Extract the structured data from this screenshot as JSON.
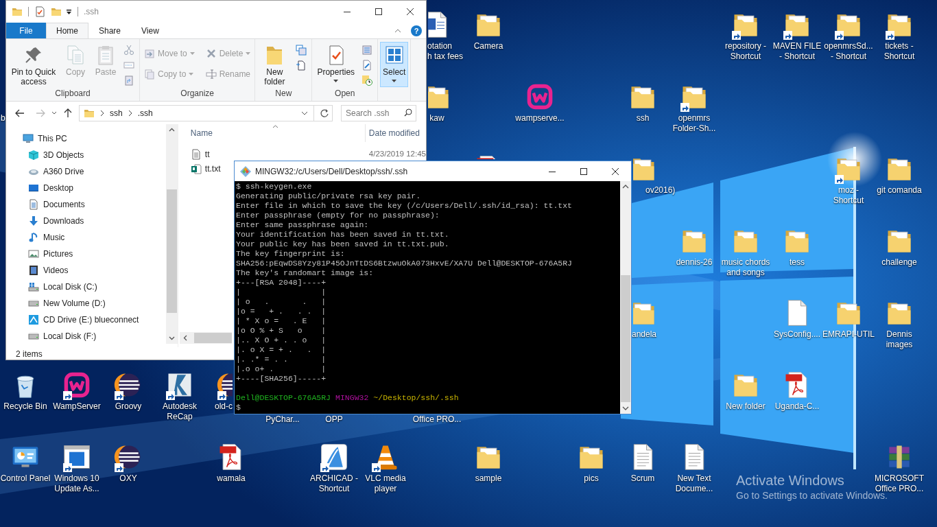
{
  "explorer": {
    "title": ".ssh",
    "tabs": [
      {
        "label": "File",
        "kind": "menu",
        "selected": false
      },
      {
        "label": "Home",
        "kind": "tab",
        "selected": true
      },
      {
        "label": "Share",
        "kind": "tab",
        "selected": false
      },
      {
        "label": "View",
        "kind": "tab",
        "selected": false
      }
    ],
    "help_label": "?",
    "ribbon": [
      {
        "label": "Clipboard",
        "items": [
          {
            "label": "Pin to Quick access",
            "kind": "pin",
            "disabled": false,
            "highlighted": false
          },
          {
            "label": "Copy",
            "kind": "copy",
            "disabled": true,
            "highlighted": false
          },
          {
            "label": "Paste",
            "kind": "paste",
            "disabled": true,
            "highlighted": false
          }
        ]
      },
      {
        "label": "Organize",
        "items": [
          {
            "label": "Move to",
            "kind": "moveto",
            "disabled": true,
            "highlighted": false
          },
          {
            "label": "Copy to",
            "kind": "copyto",
            "disabled": true,
            "highlighted": false
          },
          {
            "label": "Delete",
            "kind": "delete",
            "disabled": true,
            "highlighted": false
          },
          {
            "label": "Rename",
            "kind": "rename",
            "disabled": true,
            "highlighted": false
          }
        ]
      },
      {
        "label": "New",
        "items": [
          {
            "label": "New folder",
            "kind": "newfolder",
            "disabled": false,
            "highlighted": false
          }
        ]
      },
      {
        "label": "Open",
        "items": [
          {
            "label": "Properties",
            "kind": "properties",
            "disabled": false,
            "highlighted": false
          }
        ]
      },
      {
        "items": [
          {
            "label": "Select",
            "kind": "select",
            "disabled": false,
            "highlighted": true
          }
        ]
      }
    ],
    "path": [
      "ssh",
      ".ssh"
    ],
    "search_placeholder": "Search .ssh",
    "nav": [
      {
        "label": "This PC",
        "kind": "pc",
        "children": [
          {
            "label": "3D Objects",
            "kind": "cube"
          },
          {
            "label": "A360 Drive",
            "kind": "a360"
          },
          {
            "label": "Desktop",
            "kind": "desktop"
          },
          {
            "label": "Documents",
            "kind": "documents"
          },
          {
            "label": "Downloads",
            "kind": "downloads"
          },
          {
            "label": "Music",
            "kind": "music"
          },
          {
            "label": "Pictures",
            "kind": "pictures"
          },
          {
            "label": "Videos",
            "kind": "videos"
          },
          {
            "label": "Local Disk (C:)",
            "kind": "windisk"
          },
          {
            "label": "New Volume (D:)",
            "kind": "disk"
          },
          {
            "label": "CD Drive (E:) blueconnect",
            "kind": "bc"
          },
          {
            "label": "Local Disk (F:)",
            "kind": "disk"
          }
        ]
      }
    ],
    "columns": [
      "Name",
      "Date modified"
    ],
    "files": [
      {
        "name": "tt",
        "kind": "text",
        "date": "4/23/2019 12:45"
      },
      {
        "name": "tt.txt",
        "kind": "publisher"
      }
    ],
    "status": "2 items"
  },
  "terminal": {
    "title": "MINGW32:/c/Users/Dell/Desktop/ssh/.ssh",
    "lines": [
      "$ ssh-keygen.exe",
      "Generating public/private rsa key pair.",
      "Enter file in which to save the key (/c/Users/Dell/.ssh/id_rsa): tt.txt",
      "Enter passphrase (empty for no passphrase):",
      "Enter same passphrase again:",
      "Your identification has been saved in tt.txt.",
      "Your public key has been saved in tt.txt.pub.",
      "The key fingerprint is:",
      "SHA256:pEqwDS8Yzy81P45OJnTtDS6BtzwuOkA073HxvE/XA7U Dell@DESKTOP-676A5RJ",
      "The key's randomart image is:",
      "+---[RSA 2048]----+",
      "|                 |",
      "| o   .       .   |",
      "|o =   + .   . .  |",
      "| * X o =   . E   |",
      "|o O % + S   o    |",
      "|.. X O + . . o   |",
      "|. o X = + .   .  |",
      "|. .* = . .       |",
      "|.o o+ .          |",
      "+----[SHA256]-----+"
    ],
    "prompt": {
      "user": "Dell@DESKTOP-676A5RJ",
      "system": "MINGW32",
      "path": "~/Desktop/ssh/.ssh"
    },
    "input_line": "$"
  },
  "desktop": {
    "icons": [
      {
        "label": "otation\nh tax fees",
        "kind": "word",
        "shortcut": false
      },
      {
        "label": "Camera",
        "kind": "folder",
        "shortcut": false
      },
      {
        "label": "repository - Shortcut",
        "kind": "folder",
        "shortcut": true
      },
      {
        "label": "MAVEN FILE - Shortcut",
        "kind": "folder",
        "shortcut": true
      },
      {
        "label": "openmrsSd... - Shortcut",
        "kind": "folder",
        "shortcut": true
      },
      {
        "label": "tickets - Shortcut",
        "kind": "folder",
        "shortcut": true
      },
      {
        "label": "b"
      },
      {
        "label": "kaw",
        "kind": "folder",
        "shortcut": false
      },
      {
        "label": "wampserve...",
        "kind": "wamp",
        "shortcut": false
      },
      {
        "label": "ssh",
        "kind": "folder",
        "shortcut": false
      },
      {
        "label": "openmrs Folder-Sh...",
        "kind": "folder",
        "shortcut": true
      },
      {
        "kind": "pdf"
      },
      {
        "label": "ov2016)",
        "kind": "folder",
        "shortcut": false
      },
      {
        "label": "moz - Shortcut",
        "kind": "folder",
        "shortcut": true
      },
      {
        "label": "git comanda",
        "kind": "folder",
        "shortcut": false
      },
      {
        "label": "dennis-26",
        "kind": "folder",
        "shortcut": false
      },
      {
        "label": "music chords and songs",
        "kind": "folder",
        "shortcut": false
      },
      {
        "label": "tess",
        "kind": "folder",
        "shortcut": false
      },
      {
        "label": "challenge",
        "kind": "folder",
        "shortcut": false
      },
      {
        "label": "andela",
        "kind": "folder",
        "shortcut": false
      },
      {
        "label": "SysConfig....",
        "kind": "file",
        "shortcut": false
      },
      {
        "label": "EMRAPI-UTIL",
        "kind": "folder",
        "shortcut": false
      },
      {
        "label": "Dennis images",
        "kind": "folder",
        "shortcut": false
      },
      {
        "label": "Recycle Bin",
        "kind": "recycle",
        "shortcut": false
      },
      {
        "label": "WampServer",
        "kind": "wamp",
        "shortcut": true
      },
      {
        "label": "Groovy",
        "kind": "eclipse",
        "shortcut": true
      },
      {
        "label": "Autodesk ReCap",
        "kind": "recap",
        "shortcut": true
      },
      {
        "label": "old-c",
        "kind": "eclipse",
        "shortcut": true
      },
      {
        "label": "PyChar..."
      },
      {
        "label": "OPP"
      },
      {
        "label": "Office PRO..."
      },
      {
        "label": "New folder",
        "kind": "folder",
        "shortcut": false
      },
      {
        "label": "Uganda-C...",
        "kind": "pdf",
        "shortcut": false
      },
      {
        "label": "Control Panel",
        "kind": "control",
        "shortcut": false
      },
      {
        "label": "Windows 10 Update As...",
        "kind": "winupdate",
        "shortcut": true
      },
      {
        "label": "OXY",
        "kind": "eclipse",
        "shortcut": true
      },
      {
        "label": "wamala",
        "kind": "pdf",
        "shortcut": false
      },
      {
        "label": "ARCHICAD - Shortcut",
        "kind": "archicad",
        "shortcut": true
      },
      {
        "label": "VLC media player",
        "kind": "vlc",
        "shortcut": true
      },
      {
        "label": "sample",
        "kind": "folder",
        "shortcut": false
      },
      {
        "label": "pics",
        "kind": "folder",
        "shortcut": false
      },
      {
        "label": "Scrum",
        "kind": "text",
        "shortcut": false
      },
      {
        "label": "New Text Docume...",
        "kind": "text",
        "shortcut": false
      },
      {
        "label": "MICROSOFT Office PRO...",
        "kind": "rar",
        "shortcut": false
      }
    ],
    "activation": {
      "title": "Activate Windows",
      "subtitle": "Go to Settings to activate Windows."
    }
  }
}
